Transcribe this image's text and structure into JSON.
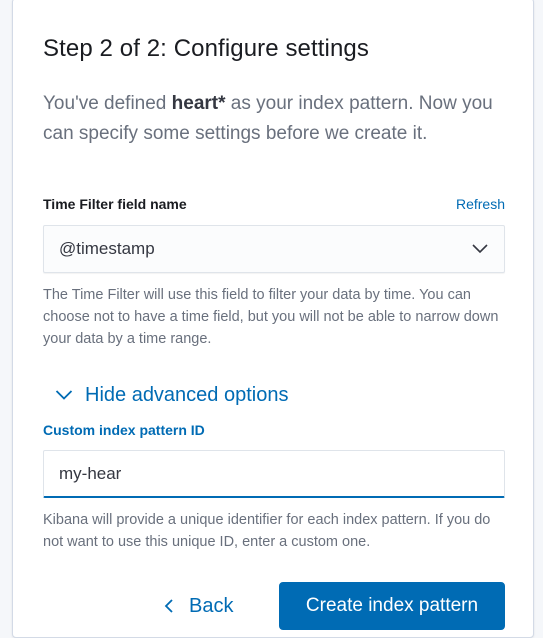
{
  "step": {
    "title": "Step 2 of 2: Configure settings",
    "lead_prefix": "You've defined ",
    "pattern": "heart*",
    "lead_suffix": " as your index pattern. Now you can specify some settings before we create it."
  },
  "time_filter": {
    "label": "Time Filter field name",
    "refresh_label": "Refresh",
    "selected_value": "@timestamp",
    "help_text": "The Time Filter will use this field to filter your data by time. You can choose not to have a time field, but you will not be able to narrow down your data by a time range."
  },
  "advanced": {
    "toggle_label": "Hide advanced options",
    "id_label": "Custom index pattern ID",
    "id_value": "my-hear",
    "help_text": "Kibana will provide a unique identifier for each index pattern. If you do not want to use this unique ID, enter a custom one."
  },
  "actions": {
    "back_label": "Back",
    "create_label": "Create index pattern"
  },
  "colors": {
    "accent": "#006bb4",
    "title": "#1a1c21",
    "subdued": "#69707d"
  },
  "icons": {
    "select": "chevron-down-icon",
    "toggle": "chevron-down-icon",
    "back": "chevron-left-icon"
  }
}
